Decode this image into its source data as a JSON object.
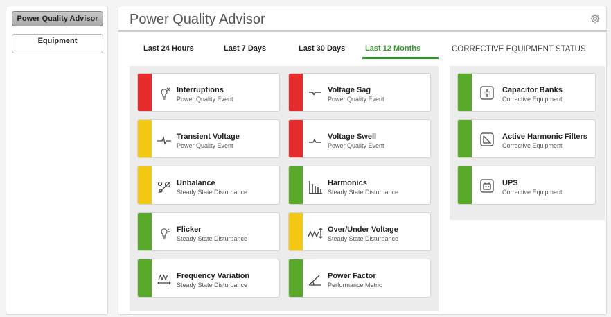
{
  "sidebar": {
    "items": [
      {
        "label": "Power Quality Advisor",
        "active": true
      },
      {
        "label": "Equipment",
        "active": false
      }
    ]
  },
  "header": {
    "title": "Power Quality Advisor",
    "settings_icon": "gear-icon"
  },
  "tabs": [
    {
      "label": "Last 24 Hours",
      "active": false
    },
    {
      "label": "Last 7 Days",
      "active": false
    },
    {
      "label": "Last 30 Days",
      "active": false
    },
    {
      "label": "Last 12 Months",
      "active": true
    }
  ],
  "colors": {
    "red": "#e52b2b",
    "yellow": "#f2c813",
    "green": "#58a82a",
    "active_tab": "#3a9a30"
  },
  "events": [
    {
      "name": "Interruptions",
      "category": "Power Quality Event",
      "status": "red",
      "icon": "bulb-off-icon"
    },
    {
      "name": "Voltage Sag",
      "category": "Power Quality Event",
      "status": "red",
      "icon": "voltage-sag-icon"
    },
    {
      "name": "Transient Voltage",
      "category": "Power Quality Event",
      "status": "yellow",
      "icon": "transient-icon"
    },
    {
      "name": "Voltage Swell",
      "category": "Power Quality Event",
      "status": "red",
      "icon": "voltage-swell-icon"
    },
    {
      "name": "Unbalance",
      "category": "Steady State Disturbance",
      "status": "yellow",
      "icon": "unbalance-icon"
    },
    {
      "name": "Harmonics",
      "category": "Steady State Disturbance",
      "status": "green",
      "icon": "harmonics-icon"
    },
    {
      "name": "Flicker",
      "category": "Steady State Disturbance",
      "status": "green",
      "icon": "bulb-flicker-icon"
    },
    {
      "name": "Over/Under Voltage",
      "category": "Steady State Disturbance",
      "status": "yellow",
      "icon": "over-under-voltage-icon"
    },
    {
      "name": "Frequency Variation",
      "category": "Steady State Disturbance",
      "status": "green",
      "icon": "frequency-icon"
    },
    {
      "name": "Power Factor",
      "category": "Performance Metric",
      "status": "green",
      "icon": "power-factor-icon"
    }
  ],
  "corrective": {
    "heading": "CORRECTIVE EQUIPMENT STATUS",
    "items": [
      {
        "name": "Capacitor Banks",
        "category": "Corrective Equipment",
        "status": "green",
        "icon": "capacitor-icon"
      },
      {
        "name": "Active Harmonic Filters",
        "category": "Corrective Equipment",
        "status": "green",
        "icon": "filter-icon"
      },
      {
        "name": "UPS",
        "category": "Corrective Equipment",
        "status": "green",
        "icon": "ups-icon"
      }
    ]
  }
}
